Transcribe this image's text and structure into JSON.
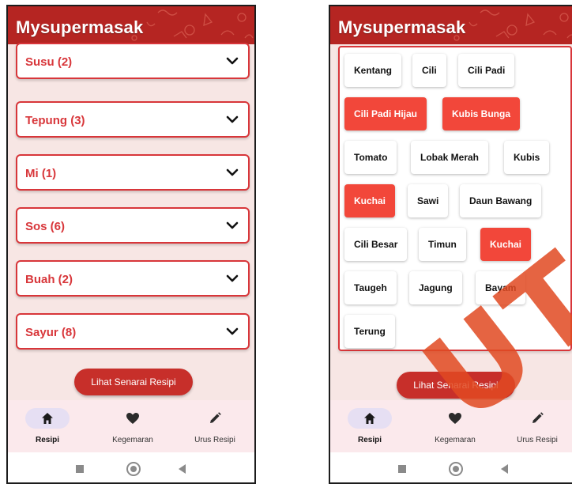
{
  "app_title": "Mysupermasak",
  "left_screen": {
    "accordion": [
      {
        "label": "Susu (2)"
      },
      {
        "label": "Tepung (3)"
      },
      {
        "label": "Mi (1)"
      },
      {
        "label": "Sos (6)"
      },
      {
        "label": "Buah (2)"
      },
      {
        "label": "Sayur (8)"
      }
    ],
    "cta_label": "Lihat Senarai Resipi"
  },
  "right_screen": {
    "chips": [
      {
        "label": "Kentang",
        "selected": false
      },
      {
        "label": "Cili",
        "selected": false
      },
      {
        "label": "Cili Padi",
        "selected": false
      },
      {
        "label": "Cili Padi Hijau",
        "selected": true
      },
      {
        "label": "Kubis Bunga",
        "selected": true
      },
      {
        "label": "Tomato",
        "selected": false
      },
      {
        "label": "Lobak Merah",
        "selected": false
      },
      {
        "label": "Kubis",
        "selected": false
      },
      {
        "label": "Kuchai",
        "selected": true
      },
      {
        "label": "Sawi",
        "selected": false
      },
      {
        "label": "Daun Bawang",
        "selected": false
      },
      {
        "label": "Cili Besar",
        "selected": false
      },
      {
        "label": "Timun",
        "selected": false
      },
      {
        "label": "Kuchai",
        "selected": true
      },
      {
        "label": "Taugeh",
        "selected": false
      },
      {
        "label": "Jagung",
        "selected": false
      },
      {
        "label": "Bayam",
        "selected": false
      },
      {
        "label": "Terung",
        "selected": false
      }
    ],
    "cta_label": "Lihat Senarai Resipi"
  },
  "nav": [
    {
      "label": "Resipi",
      "icon": "home-icon",
      "active": true
    },
    {
      "label": "Kegemaran",
      "icon": "heart-icon",
      "active": false
    },
    {
      "label": "Urus Resipi",
      "icon": "pencil-icon",
      "active": false
    }
  ],
  "system_nav": [
    "recents-icon",
    "home-circle-icon",
    "back-icon"
  ],
  "watermark": "UTeM",
  "colors": {
    "header": "#b52522",
    "accent": "#d8363a",
    "chip_selected": "#f2473a",
    "background": "#f7e6e4",
    "nav_background": "#fbe9ec",
    "nav_active_pill": "#e6dff3"
  }
}
